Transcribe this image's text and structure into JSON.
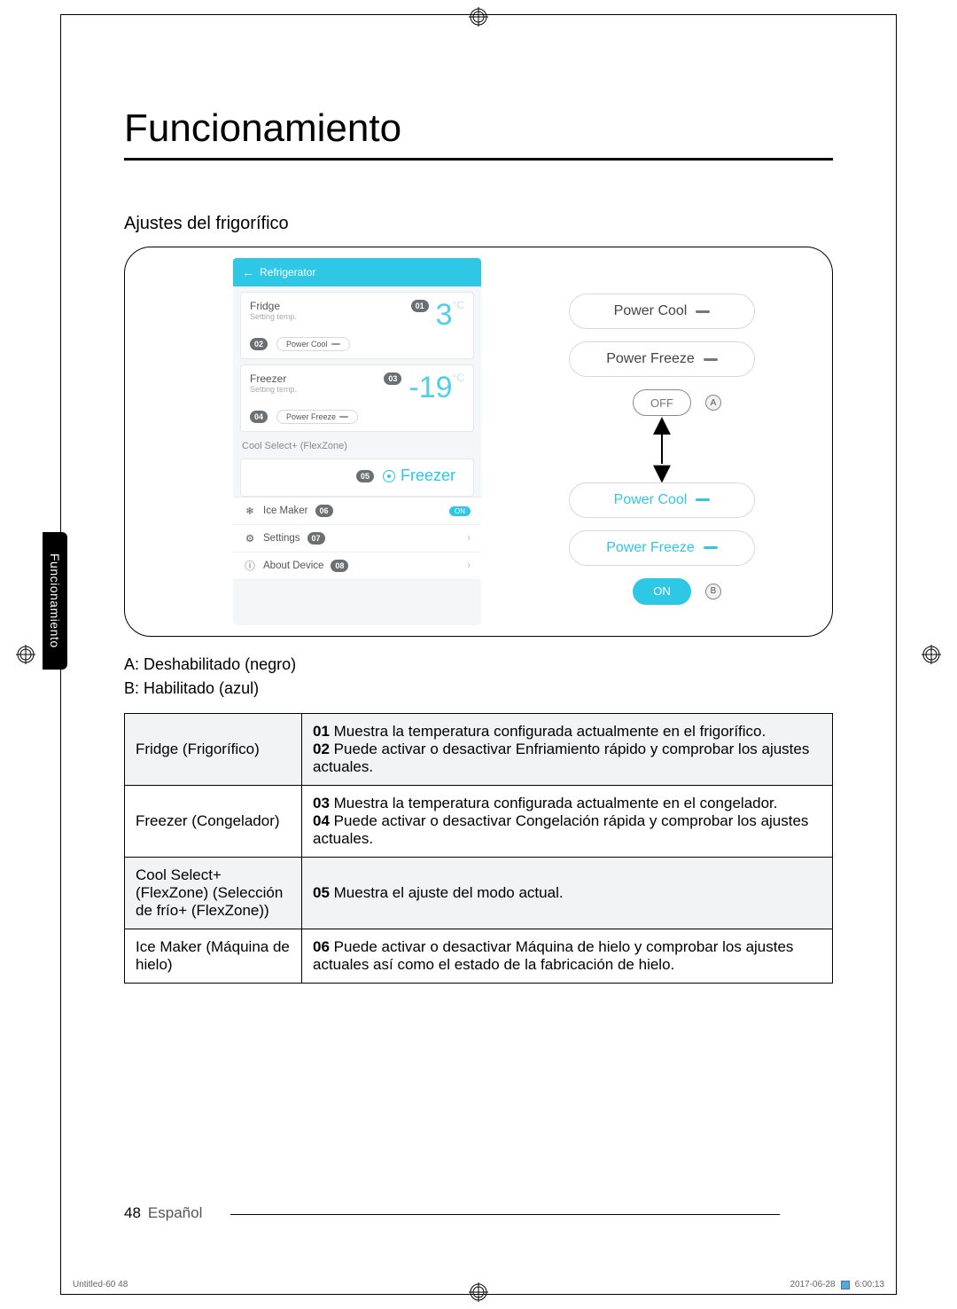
{
  "page": {
    "title": "Funcionamiento",
    "subheading": "Ajustes del frigorífico",
    "side_tab": "Funcionamiento",
    "page_number": "48",
    "language": "Español",
    "print_meta_left": "Untitled-60   48",
    "print_meta_date": "2017-06-28",
    "print_meta_time": "6:00:13"
  },
  "phone": {
    "header": "Refrigerator",
    "fridge_label": "Fridge",
    "setting_temp": "Setting temp.",
    "fridge_temp": "3",
    "fridge_unit": "°C",
    "power_cool": "Power Cool",
    "freezer_label": "Freezer",
    "freezer_temp": "-19",
    "freezer_unit": "°C",
    "power_freeze": "Power Freeze",
    "coolselect_label": "Cool Select+ (FlexZone)",
    "coolselect_value": "Freezer",
    "icemaker": "Ice Maker",
    "icemaker_state": "ON",
    "settings": "Settings",
    "about": "About Device",
    "badges": {
      "b01": "01",
      "b02": "02",
      "b03": "03",
      "b04": "04",
      "b05": "05",
      "b06": "06",
      "b07": "07",
      "b08": "08"
    }
  },
  "pills": {
    "power_cool": "Power Cool",
    "power_freeze": "Power Freeze",
    "off": "OFF",
    "on": "ON",
    "labelA": "A",
    "labelB": "B"
  },
  "legend": {
    "a": "A: Deshabilitado (negro)",
    "b": "B: Habilitado (azul)"
  },
  "table": {
    "r1_left": "Fridge (Frigorífico)",
    "r1_01n": "01",
    "r1_01t": " Muestra la temperatura configurada actualmente en el frigorífico.",
    "r1_02n": "02",
    "r1_02t": " Puede activar o desactivar Enfriamiento rápido y comprobar los ajustes actuales.",
    "r2_left": "Freezer (Congelador)",
    "r2_03n": "03",
    "r2_03t": " Muestra la temperatura configurada actualmente en el congelador.",
    "r2_04n": "04",
    "r2_04t": " Puede activar o desactivar Congelación rápida y comprobar los ajustes actuales.",
    "r3_left": "Cool Select+ (FlexZone) (Selección de frío+ (FlexZone))",
    "r3_05n": "05",
    "r3_05t": " Muestra el ajuste del modo actual.",
    "r4_left": "Ice Maker (Máquina de hielo)",
    "r4_06n": "06",
    "r4_06t": " Puede activar o desactivar Máquina de hielo y comprobar los ajustes actuales así como el estado de la fabricación de hielo."
  }
}
